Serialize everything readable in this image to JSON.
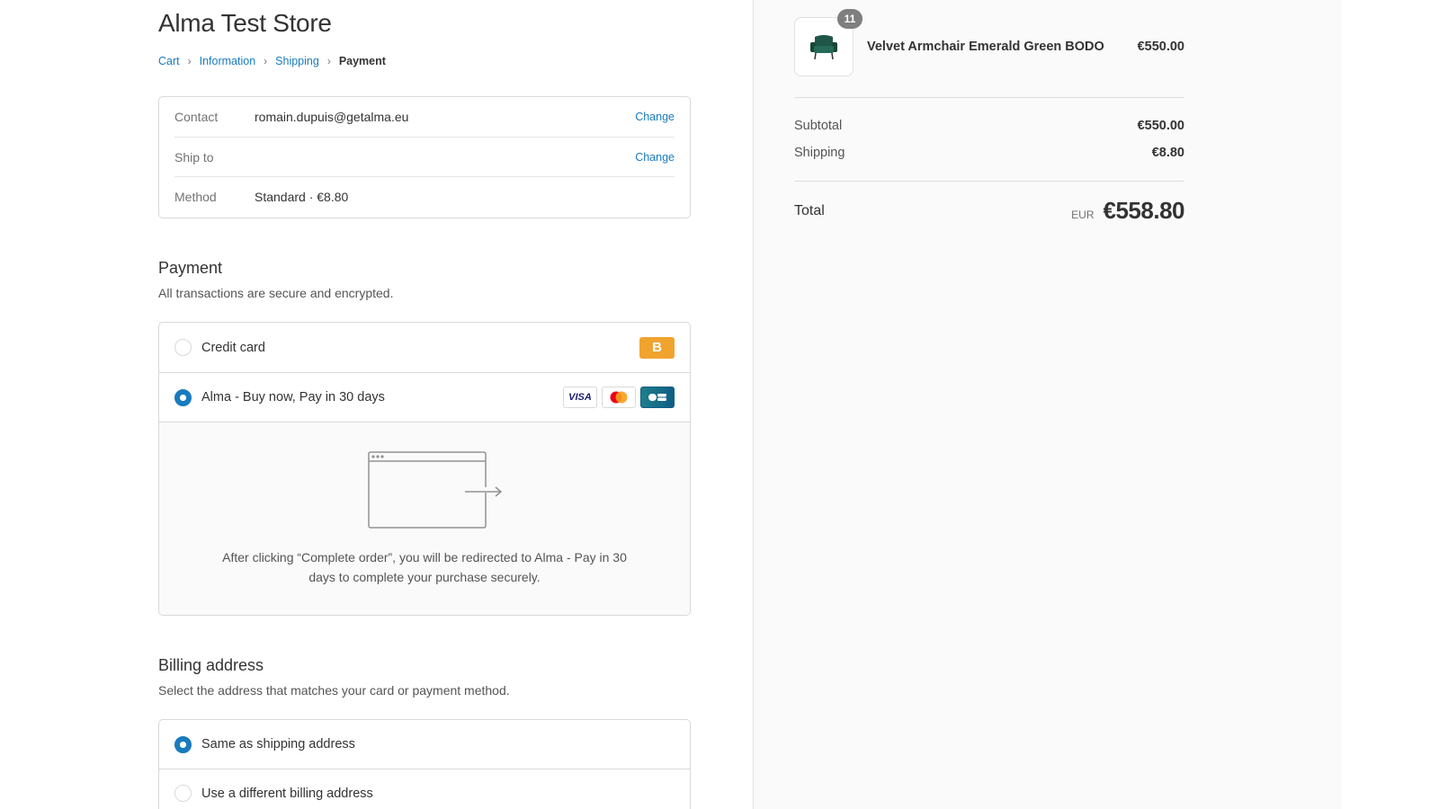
{
  "store": {
    "title": "Alma Test Store"
  },
  "breadcrumb": {
    "items": [
      "Cart",
      "Information",
      "Shipping"
    ],
    "current": "Payment"
  },
  "review": {
    "contact_label": "Contact",
    "contact_value": "romain.dupuis@getalma.eu",
    "ship_label": "Ship to",
    "ship_value": "",
    "method_label": "Method",
    "method_value": "Standard · €8.80",
    "change_label": "Change"
  },
  "payment": {
    "title": "Payment",
    "subtitle": "All transactions are secure and encrypted.",
    "options": [
      {
        "label": "Credit card",
        "selected": false,
        "badge": "B"
      },
      {
        "label": "Alma - Buy now, Pay in 30 days",
        "selected": true
      }
    ],
    "card_visa": "VISA",
    "redirect_text": "After clicking “Complete order”, you will be redirected to Alma - Pay in 30 days to complete your purchase securely."
  },
  "billing": {
    "title": "Billing address",
    "subtitle": "Select the address that matches your card or payment method.",
    "options": [
      {
        "label": "Same as shipping address",
        "selected": true
      },
      {
        "label": "Use a different billing address",
        "selected": false
      }
    ]
  },
  "summary": {
    "product": {
      "name": "Velvet Armchair Emerald Green BODO",
      "price": "€550.00",
      "quantity": "11"
    },
    "subtotal_label": "Subtotal",
    "subtotal_value": "€550.00",
    "shipping_label": "Shipping",
    "shipping_value": "€8.80",
    "total_label": "Total",
    "total_currency": "EUR",
    "total_value": "€558.80"
  },
  "colors": {
    "accent": "#197bbd",
    "badge_orange": "#f0a32f",
    "armchair_green": "#1f5648"
  }
}
